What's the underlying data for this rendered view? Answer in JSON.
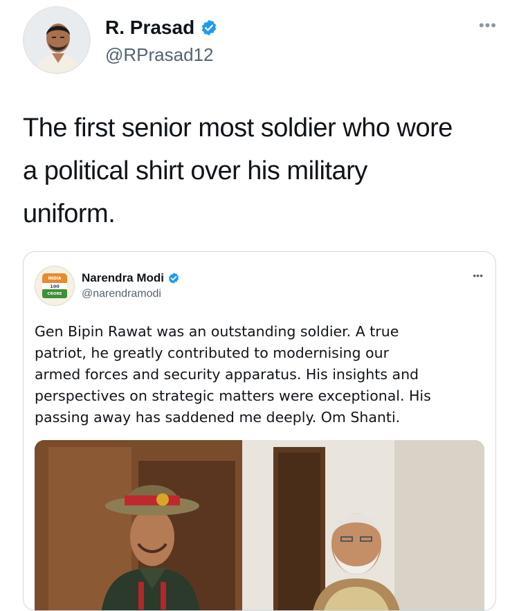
{
  "author": {
    "name": "R. Prasad",
    "handle": "@RPrasad12",
    "verified_icon": "verified-badge-icon",
    "more_label": "•••"
  },
  "tweet": {
    "lines": [
      "The first senior most soldier who wore",
      "a political shirt over his military",
      "uniform."
    ]
  },
  "quoted": {
    "name": "Narendra Modi",
    "handle": "@narendramodi",
    "more_label": "•••",
    "avatar_text": [
      "INDIA",
      "100",
      "CRORE"
    ],
    "lines": [
      "Gen Bipin Rawat was an outstanding soldier. A true",
      "patriot, he greatly contributed to modernising our",
      "armed forces and security apparatus. His insights and",
      "perspectives on strategic matters were exceptional. His",
      "passing away has saddened me deeply. Om Shanti."
    ]
  },
  "colors": {
    "verified": "#1d9bf0",
    "text": "#0f1419",
    "secondary": "#536471",
    "border": "#cfd9de"
  }
}
